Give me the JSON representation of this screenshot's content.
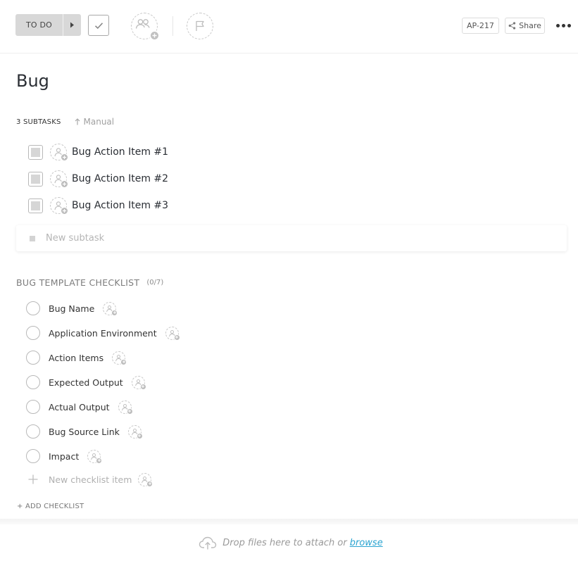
{
  "header": {
    "status_label": "TO DO",
    "task_id": "AP-217",
    "share_label": "Share",
    "icons": {
      "status_arrow": "caret-right-icon",
      "complete": "check-icon",
      "assignees": "assignees-add-icon",
      "priority": "flag-icon",
      "share": "share-icon",
      "more": "more-dots-icon"
    }
  },
  "task": {
    "title": "Bug"
  },
  "subtasks": {
    "count_label": "3 SUBTASKS",
    "sort_label": "Manual",
    "items": [
      {
        "name": "Bug Action Item #1"
      },
      {
        "name": "Bug Action Item #2"
      },
      {
        "name": "Bug Action Item #3"
      }
    ],
    "new_placeholder": "New subtask"
  },
  "checklist": {
    "title": "BUG TEMPLATE CHECKLIST",
    "count": "(0/7)",
    "items": [
      {
        "name": "Bug Name"
      },
      {
        "name": "Application Environment"
      },
      {
        "name": "Action Items"
      },
      {
        "name": "Expected Output"
      },
      {
        "name": "Actual Output"
      },
      {
        "name": "Bug Source Link"
      },
      {
        "name": "Impact"
      }
    ],
    "new_placeholder": "New checklist item",
    "add_label": "+ ADD CHECKLIST"
  },
  "footer": {
    "drop_text": "Drop files here to attach or",
    "browse_label": "browse",
    "icon": "cloud-upload-icon"
  },
  "colors": {
    "status_bg": "#d8d8d8",
    "link": "#2ba4d1",
    "muted_text": "#b5b5b5"
  }
}
